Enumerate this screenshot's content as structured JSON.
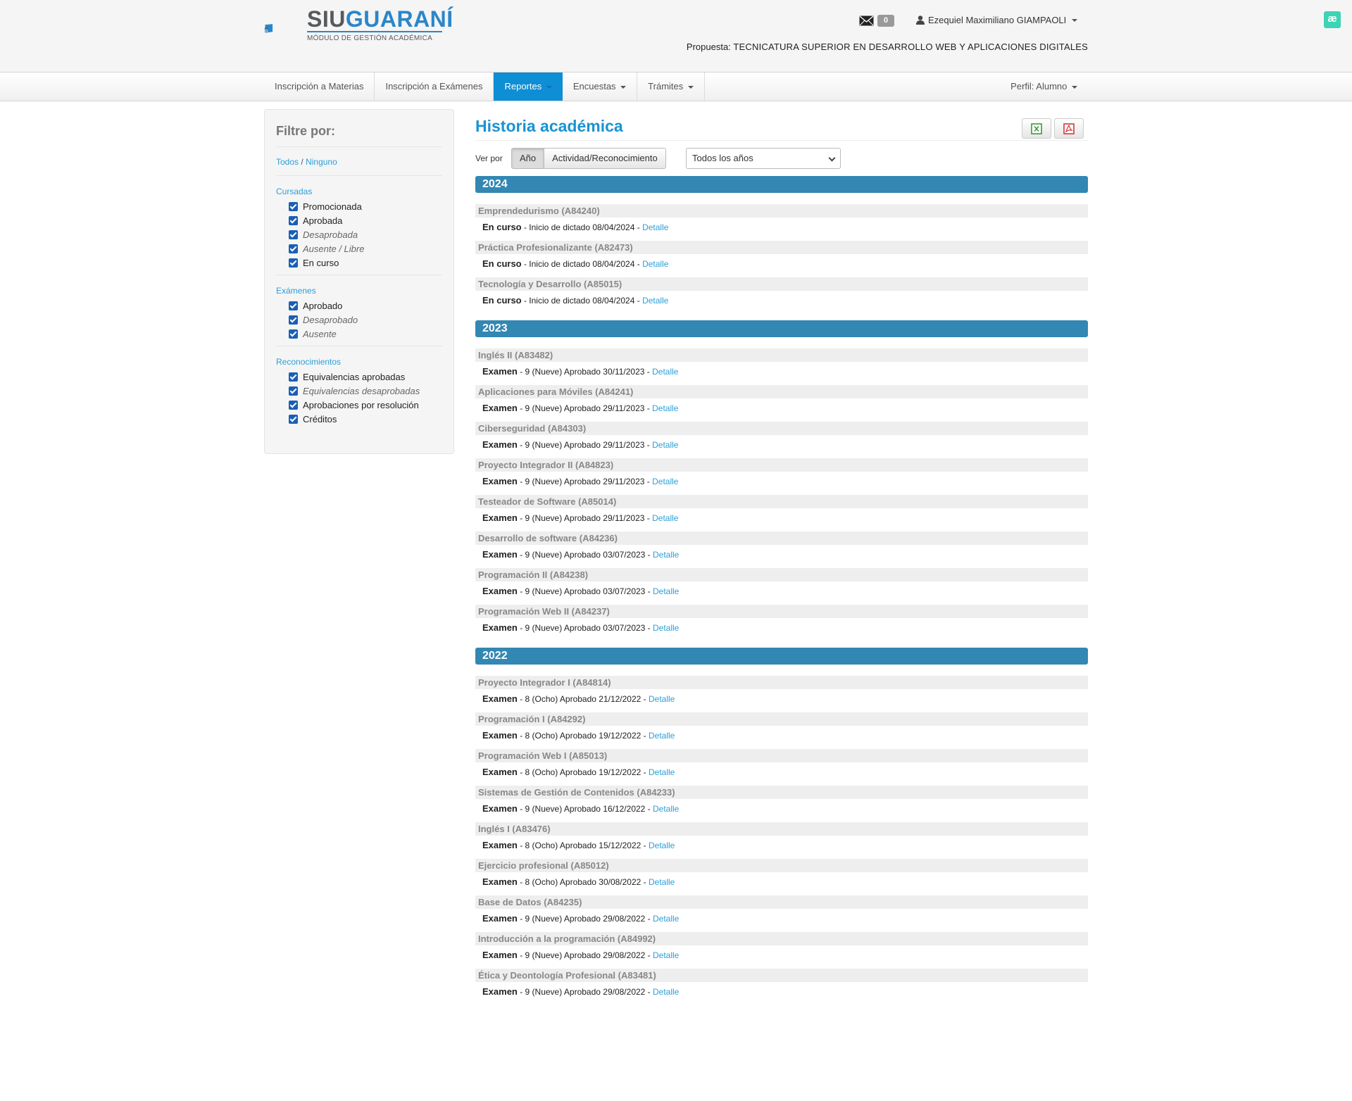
{
  "header": {
    "logo_text_a": "SIU",
    "logo_text_b": "GUARANÍ",
    "logo_subtitle": "MÓDULO DE GESTIÓN ACADÉMICA",
    "mail_count": "0",
    "user_name": "Ezequiel Maximiliano GIAMPAOLI",
    "propuesta_label": "Propuesta:",
    "propuesta_value": "TECNICATURA SUPERIOR EN DESARROLLO WEB Y APLICACIONES DIGITALES",
    "ext_badge": "æ"
  },
  "nav": {
    "items": [
      "Inscripción a Materias",
      "Inscripción a Exámenes",
      "Reportes",
      "Encuestas",
      "Trámites"
    ],
    "active": "Reportes",
    "perfil": "Perfil: Alumno"
  },
  "sidebar": {
    "title": "Filtre por:",
    "todos": "Todos",
    "sep": "/",
    "ninguno": "Ninguno",
    "cursadas": {
      "label": "Cursadas",
      "options": [
        "Promocionada",
        "Aprobada",
        "Desaprobada",
        "Ausente / Libre",
        "En curso"
      ]
    },
    "examenes": {
      "label": "Exámenes",
      "options": [
        "Aprobado",
        "Desaprobado",
        "Ausente"
      ]
    },
    "reconocimientos": {
      "label": "Reconocimientos",
      "options": [
        "Equivalencias aprobadas",
        "Equivalencias desaprobadas",
        "Aprobaciones por resolución",
        "Créditos"
      ]
    }
  },
  "main": {
    "title": "Historia académica",
    "ver_por": "Ver por",
    "seg_ano": "Año",
    "seg_actividad": "Actividad/Reconocimiento",
    "select_value": "Todos los años",
    "detail_link": "Detalle",
    "years": [
      {
        "year": "2024",
        "subjects": [
          {
            "name": "Emprendedurismo (A84240)",
            "type": "En curso",
            "text": " - Inicio de dictado 08/04/2024 - "
          },
          {
            "name": "Práctica Profesionalizante (A82473)",
            "type": "En curso",
            "text": " - Inicio de dictado 08/04/2024 - "
          },
          {
            "name": "Tecnología y Desarrollo (A85015)",
            "type": "En curso",
            "text": " - Inicio de dictado 08/04/2024 - "
          }
        ]
      },
      {
        "year": "2023",
        "subjects": [
          {
            "name": "Inglés II (A83482)",
            "type": "Examen",
            "text": " - 9 (Nueve) Aprobado 30/11/2023 - "
          },
          {
            "name": "Aplicaciones para Móviles (A84241)",
            "type": "Examen",
            "text": " - 9 (Nueve) Aprobado 29/11/2023 - "
          },
          {
            "name": "Ciberseguridad (A84303)",
            "type": "Examen",
            "text": " - 9 (Nueve) Aprobado 29/11/2023 - "
          },
          {
            "name": "Proyecto Integrador II (A84823)",
            "type": "Examen",
            "text": " - 9 (Nueve) Aprobado 29/11/2023 - "
          },
          {
            "name": "Testeador de Software (A85014)",
            "type": "Examen",
            "text": " - 9 (Nueve) Aprobado 29/11/2023 - "
          },
          {
            "name": "Desarrollo de software (A84236)",
            "type": "Examen",
            "text": " - 9 (Nueve) Aprobado 03/07/2023 - "
          },
          {
            "name": "Programación II (A84238)",
            "type": "Examen",
            "text": " - 9 (Nueve) Aprobado 03/07/2023 - "
          },
          {
            "name": "Programación Web II (A84237)",
            "type": "Examen",
            "text": " - 9 (Nueve) Aprobado 03/07/2023 - "
          }
        ]
      },
      {
        "year": "2022",
        "subjects": [
          {
            "name": "Proyecto Integrador I (A84814)",
            "type": "Examen",
            "text": " - 8 (Ocho) Aprobado 21/12/2022 - "
          },
          {
            "name": "Programación I (A84292)",
            "type": "Examen",
            "text": " - 8 (Ocho) Aprobado 19/12/2022 - "
          },
          {
            "name": "Programación Web I (A85013)",
            "type": "Examen",
            "text": " - 8 (Ocho) Aprobado 19/12/2022 - "
          },
          {
            "name": "Sistemas de Gestión de Contenidos (A84233)",
            "type": "Examen",
            "text": " - 9 (Nueve) Aprobado 16/12/2022 - "
          },
          {
            "name": "Inglés I (A83476)",
            "type": "Examen",
            "text": " - 8 (Ocho) Aprobado 15/12/2022 - "
          },
          {
            "name": "Ejercicio profesional (A85012)",
            "type": "Examen",
            "text": " - 8 (Ocho) Aprobado 30/08/2022 - "
          },
          {
            "name": "Base de Datos (A84235)",
            "type": "Examen",
            "text": " - 9 (Nueve) Aprobado 29/08/2022 - "
          },
          {
            "name": "Introducción a la programación (A84992)",
            "type": "Examen",
            "text": " - 9 (Nueve) Aprobado 29/08/2022 - "
          },
          {
            "name": "Ética y Deontología Profesional (A83481)",
            "type": "Examen",
            "text": " - 9 (Nueve) Aprobado 29/08/2022 - "
          }
        ]
      }
    ]
  },
  "colors": {
    "accent": "#0e8ed4",
    "year_bar": "#3387b3",
    "link": "#2b9fd8"
  }
}
